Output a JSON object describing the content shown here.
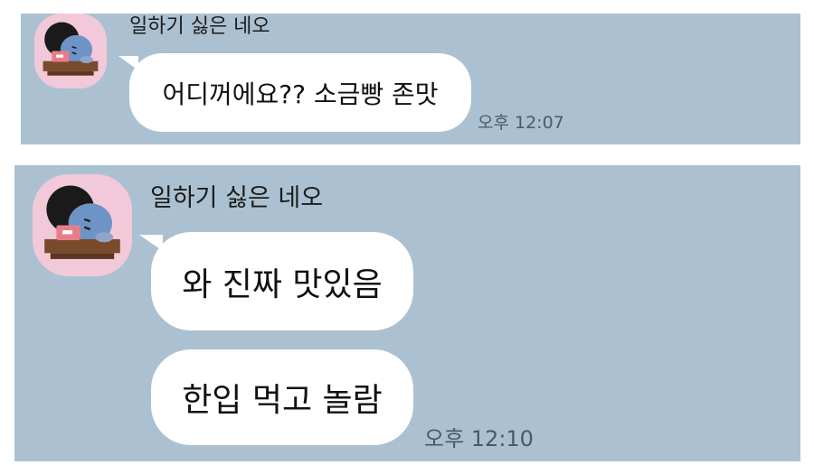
{
  "chat": {
    "sender_name": "일하기 싫은 네오",
    "blocks": [
      {
        "messages": [
          "어디꺼에요?? 소금빵 존맛"
        ],
        "time": "오후 12:07"
      },
      {
        "messages": [
          "와 진짜 맛있음",
          "한입 먹고 놀람"
        ],
        "time": "오후 12:10"
      }
    ]
  },
  "theme": {
    "chat_background": "#abc1d1",
    "bubble_color": "#ffffff",
    "avatar_background": "#f2c9d9",
    "page_background": "#ffffff"
  },
  "icons": {
    "avatar": "neo-character-sleeping-on-laptop"
  }
}
